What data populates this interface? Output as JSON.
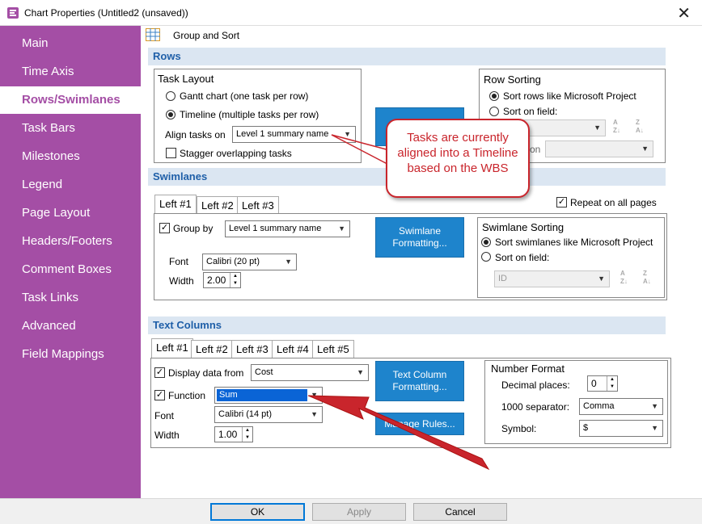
{
  "window": {
    "title": "Chart Properties (Untitled2 (unsaved))"
  },
  "sidebar": {
    "items": [
      {
        "label": "Main"
      },
      {
        "label": "Time Axis"
      },
      {
        "label": "Rows/Swimlanes"
      },
      {
        "label": "Task Bars"
      },
      {
        "label": "Milestones"
      },
      {
        "label": "Legend"
      },
      {
        "label": "Page Layout"
      },
      {
        "label": "Headers/Footers"
      },
      {
        "label": "Comment Boxes"
      },
      {
        "label": "Task Links"
      },
      {
        "label": "Advanced"
      },
      {
        "label": "Field Mappings"
      }
    ],
    "active": "Rows/Swimlanes"
  },
  "toolbar": {
    "group_sort_label": "Group and Sort"
  },
  "rows": {
    "header": "Rows",
    "task_layout": {
      "title": "Task Layout",
      "gantt_label": "Gantt chart (one task per row)",
      "timeline_label": "Timeline (multiple tasks per row)",
      "align_label": "Align tasks on",
      "align_value": "Level 1 summary name",
      "stagger_label": "Stagger overlapping tasks"
    },
    "row_sorting": {
      "title": "Row Sorting",
      "opt1": "Sort rows like Microsoft Project",
      "opt2": "Sort on field:",
      "partial_label": "on"
    }
  },
  "callout": {
    "text": "Tasks are currently aligned into a Timeline based on the WBS"
  },
  "swimlanes": {
    "header": "Swimlanes",
    "tabs": [
      "Left #1",
      "Left #2",
      "Left #3"
    ],
    "repeat_label": "Repeat on all pages",
    "group_by_label": "Group by",
    "group_by_value": "Level 1 summary name",
    "font_label": "Font",
    "font_value": "Calibri (20 pt)",
    "width_label": "Width",
    "width_value": "2.00",
    "formatting_button": "Swimlane Formatting...",
    "sorting": {
      "title": "Swimlane Sorting",
      "opt1": "Sort swimlanes like Microsoft Project",
      "opt2": "Sort on field:",
      "field_value": "ID"
    }
  },
  "text_columns": {
    "header": "Text Columns",
    "tabs": [
      "Left #1",
      "Left #2",
      "Left #3",
      "Left #4",
      "Left #5"
    ],
    "display_label": "Display data from",
    "display_value": "Cost",
    "function_label": "Function",
    "function_value": "Sum",
    "font_label": "Font",
    "font_value": "Calibri (14 pt)",
    "width_label": "Width",
    "width_value": "1.00",
    "formatting_button": "Text Column Formatting...",
    "manage_rules_button": "Manage Rules...",
    "number_format": {
      "title": "Number Format",
      "decimal_label": "Decimal places:",
      "decimal_value": "0",
      "separator_label": "1000 separator:",
      "separator_value": "Comma",
      "symbol_label": "Symbol:",
      "symbol_value": "$"
    }
  },
  "footer": {
    "ok": "OK",
    "apply": "Apply",
    "cancel": "Cancel"
  },
  "colors": {
    "sidebar": "#a44ea5",
    "accent_blue": "#1e84cc",
    "callout_red": "#c9252c",
    "section_bg": "#dbe6f2"
  }
}
